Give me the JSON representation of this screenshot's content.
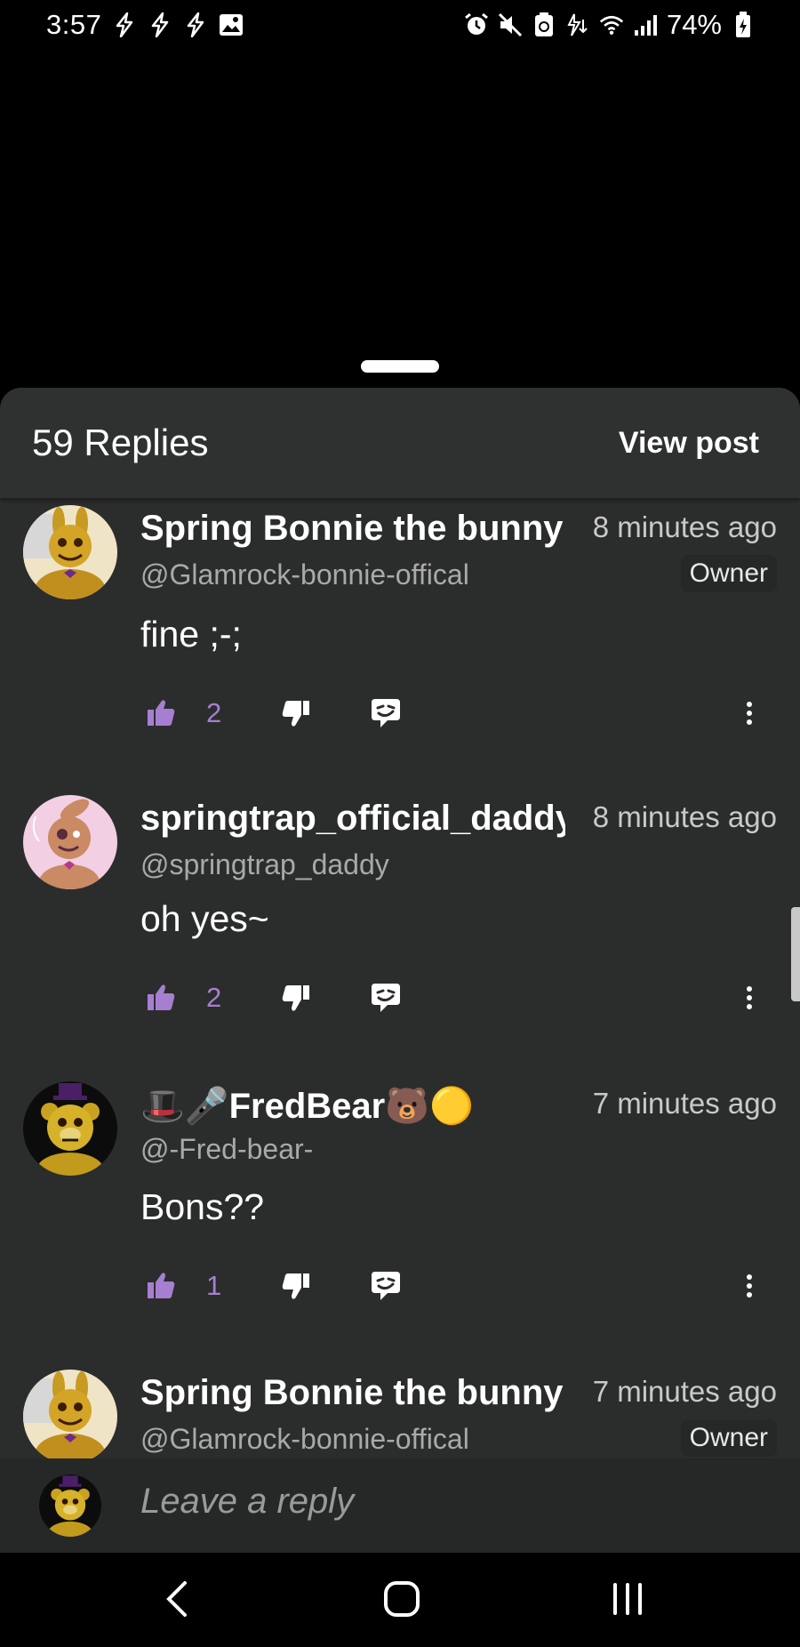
{
  "status_bar": {
    "time": "3:57",
    "battery": "74%",
    "left_icons": [
      "flash-icon",
      "flash-icon",
      "flash-icon",
      "gallery-icon"
    ],
    "right_icons": [
      "alarm-icon",
      "mute-icon",
      "sync-icon",
      "data-icon",
      "wifi-icon",
      "signal-icon",
      "battery-icon"
    ]
  },
  "sheet": {
    "replies_label": "59 Replies",
    "view_post_label": "View post"
  },
  "comments": [
    {
      "username": "Spring Bonnie the bunny",
      "handle": "@Glamrock-bonnie-offical",
      "time": "8 minutes ago",
      "badge": "Owner",
      "text": "fine ;-;",
      "likes": "2"
    },
    {
      "username": "springtrap_official_daddy",
      "handle": "@springtrap_daddy",
      "time": "8 minutes ago",
      "badge": "",
      "text": "oh yes~",
      "likes": "2"
    },
    {
      "username": "🎩🎤FredBear🐻🟡",
      "handle": "@-Fred-bear-",
      "time": "7 minutes ago",
      "badge": "",
      "text": "Bons??",
      "likes": "1"
    },
    {
      "username": "Spring Bonnie the bunny",
      "handle": "@Glamrock-bonnie-offical",
      "time": "7 minutes ago",
      "badge": "Owner",
      "text": "",
      "likes": ""
    }
  ],
  "reply_bar": {
    "placeholder": "Leave a reply"
  },
  "colors": {
    "accent_purple": "#a77fd1",
    "sheet_bg": "#2b2d2c",
    "header_bg": "#2f3131"
  }
}
